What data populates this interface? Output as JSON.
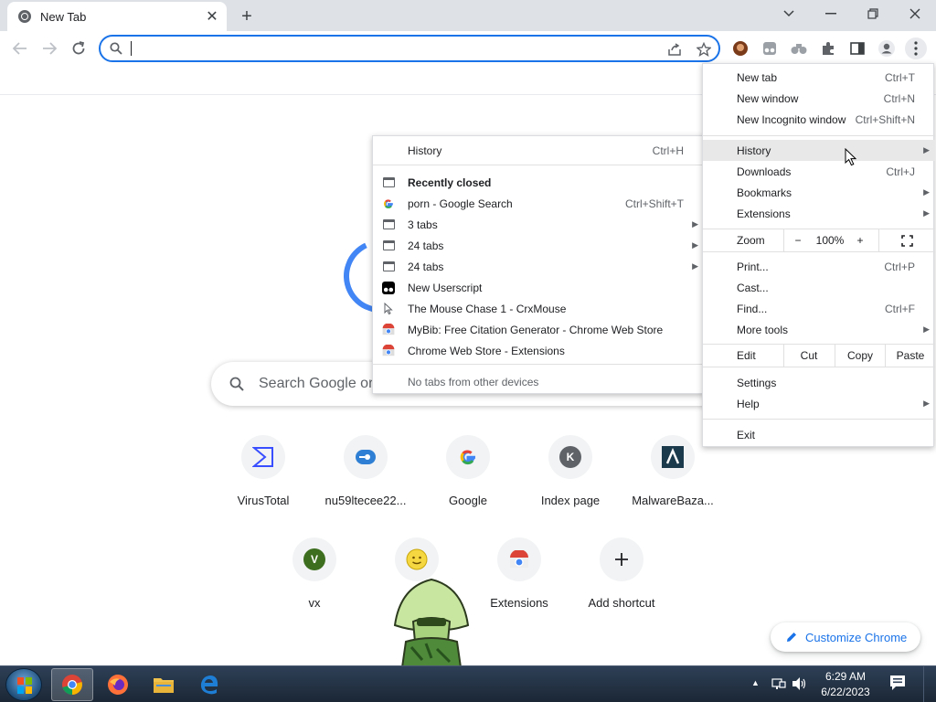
{
  "browser": {
    "tab": {
      "title": "New Tab",
      "close_glyph": "✕"
    },
    "new_tab_glyph": "+",
    "window_controls": {
      "search_tabs": "⌄",
      "minimize": "—",
      "restore": "❐",
      "close": "✕"
    },
    "omnibox": {
      "value": "",
      "placeholder": ""
    }
  },
  "ntp": {
    "search_placeholder": "Search Google or",
    "shortcuts_row1": [
      {
        "label": "VirusTotal",
        "icon": "virustotal-icon"
      },
      {
        "label": "nu59ltecee22...",
        "icon": "site-icon"
      },
      {
        "label": "Google",
        "icon": "google-icon"
      },
      {
        "label": "Index page",
        "icon": "letter-k-icon",
        "letter": "K"
      },
      {
        "label": "MalwareBaza...",
        "icon": "malwarebazaar-icon"
      }
    ],
    "shortcuts_row2": [
      {
        "label": "vx",
        "icon": "letter-v-icon",
        "letter": "V"
      },
      {
        "label": "",
        "icon": "smiley-icon"
      },
      {
        "label": "Extensions",
        "icon": "webstore-icon"
      },
      {
        "label": "Add shortcut",
        "icon": "plus-icon"
      }
    ],
    "customize_label": "Customize Chrome"
  },
  "main_menu": {
    "new_tab": {
      "label": "New tab",
      "shortcut": "Ctrl+T"
    },
    "new_window": {
      "label": "New window",
      "shortcut": "Ctrl+N"
    },
    "new_incognito": {
      "label": "New Incognito window",
      "shortcut": "Ctrl+Shift+N"
    },
    "history": {
      "label": "History"
    },
    "downloads": {
      "label": "Downloads",
      "shortcut": "Ctrl+J"
    },
    "bookmarks": {
      "label": "Bookmarks"
    },
    "extensions": {
      "label": "Extensions"
    },
    "zoom": {
      "label": "Zoom",
      "minus": "−",
      "value": "100%",
      "plus": "+"
    },
    "print": {
      "label": "Print...",
      "shortcut": "Ctrl+P"
    },
    "cast": {
      "label": "Cast..."
    },
    "find": {
      "label": "Find...",
      "shortcut": "Ctrl+F"
    },
    "more_tools": {
      "label": "More tools"
    },
    "edit": {
      "label": "Edit",
      "cut": "Cut",
      "copy": "Copy",
      "paste": "Paste"
    },
    "settings": {
      "label": "Settings"
    },
    "help": {
      "label": "Help"
    },
    "exit": {
      "label": "Exit"
    }
  },
  "history_menu": {
    "history": {
      "label": "History",
      "shortcut": "Ctrl+H"
    },
    "recently_closed": "Recently closed",
    "items": [
      {
        "label": "porn - Google Search",
        "shortcut": "Ctrl+Shift+T",
        "icon": "google-icon"
      },
      {
        "label": "3 tabs",
        "icon": "tab-group-icon",
        "submenu": true
      },
      {
        "label": "24 tabs",
        "icon": "tab-group-icon",
        "submenu": true
      },
      {
        "label": "24 tabs",
        "icon": "tab-group-icon",
        "submenu": true
      },
      {
        "label": "New Userscript",
        "icon": "tampermonkey-icon"
      },
      {
        "label": "The Mouse Chase 1 - CrxMouse",
        "icon": "cursor-icon"
      },
      {
        "label": "MyBib: Free Citation Generator - Chrome Web Store",
        "icon": "webstore-icon"
      },
      {
        "label": "Chrome Web Store - Extensions",
        "icon": "webstore-icon"
      }
    ],
    "no_tabs": "No tabs from other devices"
  },
  "taskbar": {
    "time": "6:29 AM",
    "date": "6/22/2023"
  }
}
